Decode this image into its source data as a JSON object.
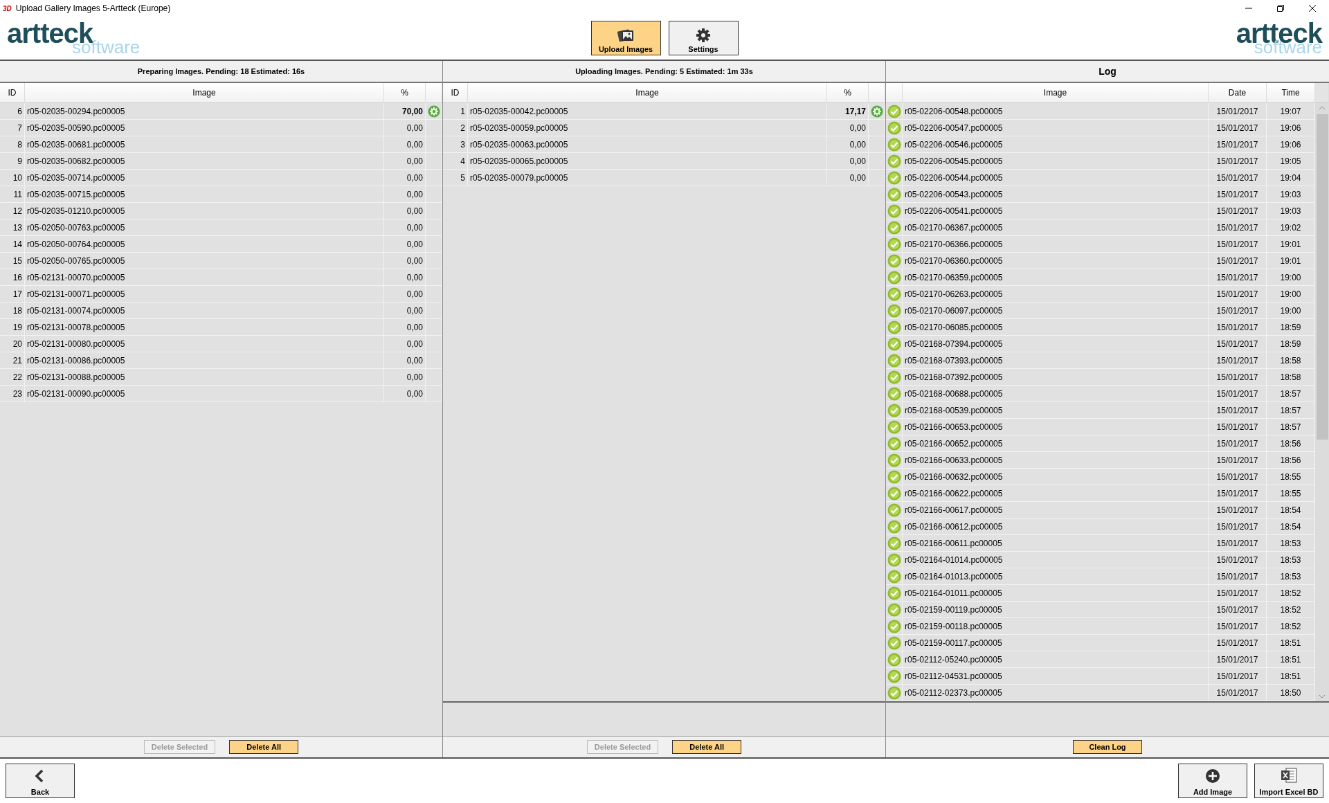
{
  "window": {
    "title": "Upload Gallery Images 5-Artteck (Europe)",
    "app_badge": "3D"
  },
  "logos": [
    {
      "word": "artteck",
      "sub": "software"
    },
    {
      "word": "artteck",
      "sub": "software"
    }
  ],
  "tabs": [
    {
      "label": "Upload Images",
      "kind": "picture",
      "selected": true
    },
    {
      "label": "Settings",
      "kind": "gear",
      "selected": false
    }
  ],
  "panels": [
    {
      "title": "Preparing Images. Pending: 18 Estimated: 16s",
      "columns": [
        "ID",
        "Image",
        "%"
      ],
      "rows": [
        {
          "id": "6",
          "image": "r05-02035-00294.pc00005",
          "percent": "70,00",
          "active": true
        },
        {
          "id": "7",
          "image": "r05-02035-00590.pc00005",
          "percent": "0,00",
          "active": false
        },
        {
          "id": "8",
          "image": "r05-02035-00681.pc00005",
          "percent": "0,00",
          "active": false
        },
        {
          "id": "9",
          "image": "r05-02035-00682.pc00005",
          "percent": "0,00",
          "active": false
        },
        {
          "id": "10",
          "image": "r05-02035-00714.pc00005",
          "percent": "0,00",
          "active": false
        },
        {
          "id": "11",
          "image": "r05-02035-00715.pc00005",
          "percent": "0,00",
          "active": false
        },
        {
          "id": "12",
          "image": "r05-02035-01210.pc00005",
          "percent": "0,00",
          "active": false
        },
        {
          "id": "13",
          "image": "r05-02050-00763.pc00005",
          "percent": "0,00",
          "active": false
        },
        {
          "id": "14",
          "image": "r05-02050-00764.pc00005",
          "percent": "0,00",
          "active": false
        },
        {
          "id": "15",
          "image": "r05-02050-00765.pc00005",
          "percent": "0,00",
          "active": false
        },
        {
          "id": "16",
          "image": "r05-02131-00070.pc00005",
          "percent": "0,00",
          "active": false
        },
        {
          "id": "17",
          "image": "r05-02131-00071.pc00005",
          "percent": "0,00",
          "active": false
        },
        {
          "id": "18",
          "image": "r05-02131-00074.pc00005",
          "percent": "0,00",
          "active": false
        },
        {
          "id": "19",
          "image": "r05-02131-00078.pc00005",
          "percent": "0,00",
          "active": false
        },
        {
          "id": "20",
          "image": "r05-02131-00080.pc00005",
          "percent": "0,00",
          "active": false
        },
        {
          "id": "21",
          "image": "r05-02131-00086.pc00005",
          "percent": "0,00",
          "active": false
        },
        {
          "id": "22",
          "image": "r05-02131-00088.pc00005",
          "percent": "0,00",
          "active": false
        },
        {
          "id": "23",
          "image": "r05-02131-00090.pc00005",
          "percent": "0,00",
          "active": false
        }
      ],
      "buttons": [
        {
          "label": "Delete Selected",
          "disabled": true
        },
        {
          "label": "Delete All",
          "disabled": false
        }
      ]
    },
    {
      "title": "Uploading Images. Pending: 5 Estimated: 1m 33s",
      "columns": [
        "ID",
        "Image",
        "%"
      ],
      "rows": [
        {
          "id": "1",
          "image": "r05-02035-00042.pc00005",
          "percent": "17,17",
          "active": true
        },
        {
          "id": "2",
          "image": "r05-02035-00059.pc00005",
          "percent": "0,00",
          "active": false
        },
        {
          "id": "3",
          "image": "r05-02035-00063.pc00005",
          "percent": "0,00",
          "active": false
        },
        {
          "id": "4",
          "image": "r05-02035-00065.pc00005",
          "percent": "0,00",
          "active": false
        },
        {
          "id": "5",
          "image": "r05-02035-00079.pc00005",
          "percent": "0,00",
          "active": false
        }
      ],
      "buttons": [
        {
          "label": "Delete Selected",
          "disabled": true
        },
        {
          "label": "Delete All",
          "disabled": false
        }
      ]
    }
  ],
  "log": {
    "title": "Log",
    "columns": [
      "Image",
      "Date",
      "Time"
    ],
    "rows": [
      {
        "image": "r05-02206-00548.pc00005",
        "date": "15/01/2017",
        "time": "19:07"
      },
      {
        "image": "r05-02206-00547.pc00005",
        "date": "15/01/2017",
        "time": "19:06"
      },
      {
        "image": "r05-02206-00546.pc00005",
        "date": "15/01/2017",
        "time": "19:06"
      },
      {
        "image": "r05-02206-00545.pc00005",
        "date": "15/01/2017",
        "time": "19:05"
      },
      {
        "image": "r05-02206-00544.pc00005",
        "date": "15/01/2017",
        "time": "19:04"
      },
      {
        "image": "r05-02206-00543.pc00005",
        "date": "15/01/2017",
        "time": "19:03"
      },
      {
        "image": "r05-02206-00541.pc00005",
        "date": "15/01/2017",
        "time": "19:03"
      },
      {
        "image": "r05-02170-06367.pc00005",
        "date": "15/01/2017",
        "time": "19:02"
      },
      {
        "image": "r05-02170-06366.pc00005",
        "date": "15/01/2017",
        "time": "19:01"
      },
      {
        "image": "r05-02170-06360.pc00005",
        "date": "15/01/2017",
        "time": "19:01"
      },
      {
        "image": "r05-02170-06359.pc00005",
        "date": "15/01/2017",
        "time": "19:00"
      },
      {
        "image": "r05-02170-06263.pc00005",
        "date": "15/01/2017",
        "time": "19:00"
      },
      {
        "image": "r05-02170-06097.pc00005",
        "date": "15/01/2017",
        "time": "19:00"
      },
      {
        "image": "r05-02170-06085.pc00005",
        "date": "15/01/2017",
        "time": "18:59"
      },
      {
        "image": "r05-02168-07394.pc00005",
        "date": "15/01/2017",
        "time": "18:59"
      },
      {
        "image": "r05-02168-07393.pc00005",
        "date": "15/01/2017",
        "time": "18:58"
      },
      {
        "image": "r05-02168-07392.pc00005",
        "date": "15/01/2017",
        "time": "18:58"
      },
      {
        "image": "r05-02168-00688.pc00005",
        "date": "15/01/2017",
        "time": "18:57"
      },
      {
        "image": "r05-02168-00539.pc00005",
        "date": "15/01/2017",
        "time": "18:57"
      },
      {
        "image": "r05-02166-00653.pc00005",
        "date": "15/01/2017",
        "time": "18:57"
      },
      {
        "image": "r05-02166-00652.pc00005",
        "date": "15/01/2017",
        "time": "18:56"
      },
      {
        "image": "r05-02166-00633.pc00005",
        "date": "15/01/2017",
        "time": "18:56"
      },
      {
        "image": "r05-02166-00632.pc00005",
        "date": "15/01/2017",
        "time": "18:55"
      },
      {
        "image": "r05-02166-00622.pc00005",
        "date": "15/01/2017",
        "time": "18:55"
      },
      {
        "image": "r05-02166-00617.pc00005",
        "date": "15/01/2017",
        "time": "18:54"
      },
      {
        "image": "r05-02166-00612.pc00005",
        "date": "15/01/2017",
        "time": "18:54"
      },
      {
        "image": "r05-02166-00611.pc00005",
        "date": "15/01/2017",
        "time": "18:53"
      },
      {
        "image": "r05-02164-01014.pc00005",
        "date": "15/01/2017",
        "time": "18:53"
      },
      {
        "image": "r05-02164-01013.pc00005",
        "date": "15/01/2017",
        "time": "18:53"
      },
      {
        "image": "r05-02164-01011.pc00005",
        "date": "15/01/2017",
        "time": "18:52"
      },
      {
        "image": "r05-02159-00119.pc00005",
        "date": "15/01/2017",
        "time": "18:52"
      },
      {
        "image": "r05-02159-00118.pc00005",
        "date": "15/01/2017",
        "time": "18:52"
      },
      {
        "image": "r05-02159-00117.pc00005",
        "date": "15/01/2017",
        "time": "18:51"
      },
      {
        "image": "r05-02112-05240.pc00005",
        "date": "15/01/2017",
        "time": "18:51"
      },
      {
        "image": "r05-02112-04531.pc00005",
        "date": "15/01/2017",
        "time": "18:51"
      },
      {
        "image": "r05-02112-02373.pc00005",
        "date": "15/01/2017",
        "time": "18:50"
      }
    ],
    "buttons": [
      {
        "label": "Clean Log",
        "disabled": false
      }
    ]
  },
  "footer": [
    {
      "label": "Back",
      "kind": "back"
    },
    {
      "label": "Add Image",
      "kind": "add"
    },
    {
      "label": "Import Excel BD",
      "kind": "excel"
    }
  ]
}
